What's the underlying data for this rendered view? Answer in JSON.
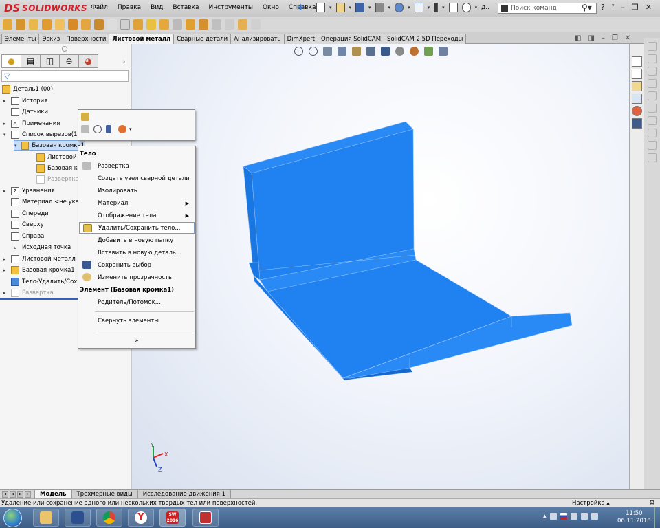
{
  "app": {
    "logo_ds": "DS",
    "logo_name": "SOLIDWORKS"
  },
  "menu": [
    "Файл",
    "Правка",
    "Вид",
    "Вставка",
    "Инструменты",
    "Окно",
    "Справка"
  ],
  "quick_access_trailing": "д..",
  "search": {
    "placeholder": "Поиск команд"
  },
  "ribbon_tabs": [
    "Элементы",
    "Эскиз",
    "Поверхности",
    "Листовой металл",
    "Сварные детали",
    "Анализировать",
    "DimXpert",
    "Операция SolidCAM",
    "SolidCAM 2.5D Переходы"
  ],
  "ribbon_active_tab": "Листовой металл",
  "feature_tree": {
    "root": "Деталь1  (00)",
    "items": [
      {
        "label": "История",
        "icon": "history-icon"
      },
      {
        "label": "Датчики",
        "icon": "sensor-icon"
      },
      {
        "label": "Примечания",
        "icon": "annotations-icon"
      },
      {
        "label": "Список вырезов(1)",
        "icon": "cut-list-icon"
      },
      {
        "label": "Базовая кромка1",
        "icon": "base-flange-icon"
      },
      {
        "label": "Листовой",
        "icon": "sheet-metal-icon"
      },
      {
        "label": "Базовая кр",
        "icon": "base-flange-feature-icon"
      },
      {
        "label": "Развертка",
        "icon": "flat-pattern-icon"
      },
      {
        "label": "Уравнения",
        "icon": "equations-icon"
      },
      {
        "label": "Материал <не указ",
        "icon": "material-icon"
      },
      {
        "label": "Спереди",
        "icon": "plane-icon"
      },
      {
        "label": "Сверху",
        "icon": "plane-icon"
      },
      {
        "label": "Справа",
        "icon": "plane-icon"
      },
      {
        "label": "Исходная точка",
        "icon": "origin-icon"
      },
      {
        "label": "Листовой металл",
        "icon": "sheet-metal-icon"
      },
      {
        "label": "Базовая кромка1",
        "icon": "base-flange-feature-icon"
      },
      {
        "label": "Тело-Удалить/Сох",
        "icon": "body-delete-icon"
      },
      {
        "label": "Развертка",
        "icon": "flat-pattern-icon"
      }
    ]
  },
  "context_menu": {
    "section_body": "Тело",
    "items": [
      {
        "label": "Развертка",
        "icon": "flat-pattern-icon"
      },
      {
        "label": "Создать узел сварной детали",
        "icon": ""
      },
      {
        "label": "Изолировать",
        "icon": ""
      },
      {
        "label": "Материал",
        "icon": "",
        "submenu": true
      },
      {
        "label": "Отображение тела",
        "icon": "",
        "submenu": true
      },
      {
        "label": "Удалить/Сохранить тело...",
        "icon": "delete-body-icon",
        "highlighted": true
      },
      {
        "label": "Добавить в новую папку",
        "icon": ""
      },
      {
        "label": "Вставить в новую деталь...",
        "icon": ""
      },
      {
        "label": "Сохранить выбор",
        "icon": "save-selection-icon"
      },
      {
        "label": "Изменить прозрачность",
        "icon": "transparency-icon"
      }
    ],
    "section_feature": "Элемент (Базовая кромка1)",
    "items2": [
      {
        "label": "Родитель/Потомок..."
      },
      {
        "label": "Свернуть элементы"
      }
    ],
    "more": "»"
  },
  "bottom_tabs": [
    "Модель",
    "Трехмерные виды",
    "Исследование движения 1"
  ],
  "bottom_active_tab": "Модель",
  "status": {
    "text": "Удаление или сохранение одного или нескольких твердых тел или поверхностей.",
    "right": "Настройка"
  },
  "taskbar": {
    "time": "11:50",
    "date": "06.11.2018",
    "sw_badge": "2016"
  },
  "triad": {
    "x": "X",
    "y": "Y",
    "z": "Z"
  },
  "colors": {
    "model_blue": "#1e7ff0",
    "brand_red": "#d0202a"
  }
}
